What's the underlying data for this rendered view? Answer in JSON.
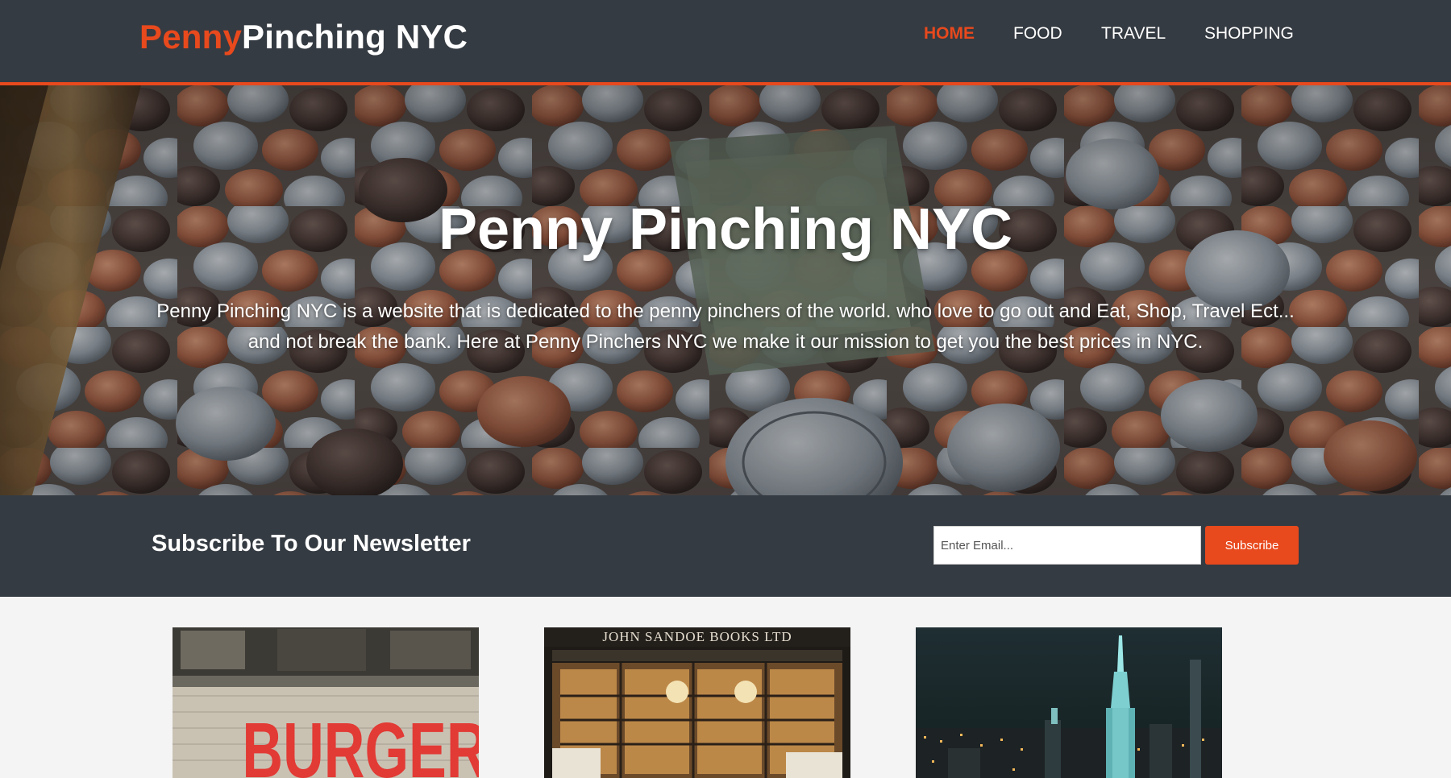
{
  "header": {
    "logo_highlight": "Penny",
    "logo_rest": "Pinching NYC",
    "nav": [
      {
        "label": "HOME",
        "active": true
      },
      {
        "label": "FOOD",
        "active": false
      },
      {
        "label": "TRAVEL",
        "active": false
      },
      {
        "label": "SHOPPING",
        "active": false
      }
    ]
  },
  "hero": {
    "title": "Penny Pinching NYC",
    "text": "Penny Pinching NYC is a website that is dedicated to the penny pinchers of the world. who love to go out and Eat, Shop, Travel Ect... and not break the bank. Here at Penny Pinchers NYC we make it our mission to get you the best prices in NYC."
  },
  "newsletter": {
    "heading": "Subscribe To Our Newsletter",
    "email_placeholder": "Enter Email...",
    "button_label": "Subscribe"
  },
  "boxes": {
    "food_sign": "BURGERS",
    "shop_sign": "JOHN SANDOE BOOKS LTD"
  },
  "colors": {
    "accent": "#e8491d",
    "header_bg": "#353b42",
    "page_bg": "#f4f4f4"
  }
}
